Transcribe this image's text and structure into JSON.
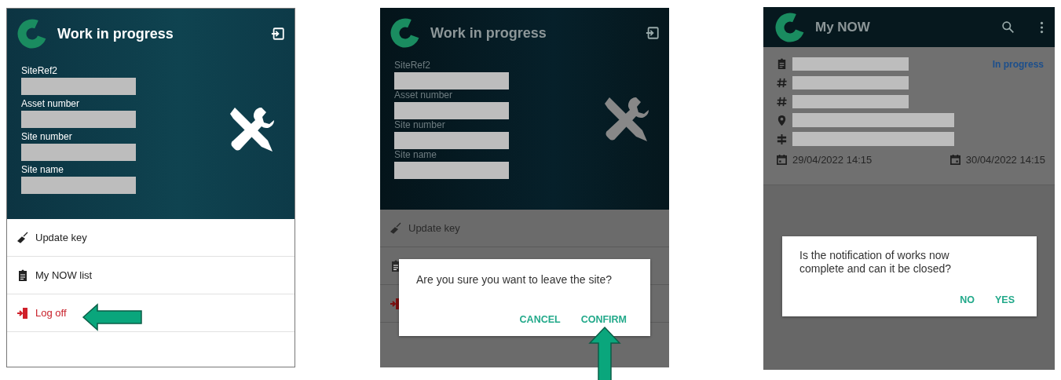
{
  "panels": [
    {
      "kind": "site",
      "dimmed": false,
      "title": "Work in progress",
      "fields": [
        "SiteRef2",
        "Asset number",
        "Site number",
        "Site name"
      ],
      "menu": [
        {
          "kind": "key",
          "label": "Update key"
        },
        {
          "kind": "list",
          "label": "My NOW list"
        },
        {
          "kind": "logoff",
          "label": "Log off"
        }
      ],
      "pointer": {
        "kind": "left"
      }
    },
    {
      "kind": "site",
      "dimmed": true,
      "title": "Work in progress",
      "fields": [
        "SiteRef2",
        "Asset number",
        "Site number",
        "Site name"
      ],
      "menu": [
        {
          "kind": "key",
          "label": "Update key"
        },
        {
          "kind": "list"
        },
        {
          "kind": "logoff"
        }
      ],
      "dialog": {
        "message": "Are you sure you want to leave the site?",
        "buttons": [
          "CANCEL",
          "CONFIRM"
        ]
      },
      "pointer": {
        "kind": "up"
      }
    },
    {
      "kind": "now",
      "dimmed": true,
      "title": "My NOW",
      "status": "In progress",
      "rows": [
        {
          "kind": "clipboard"
        },
        {
          "kind": "hash"
        },
        {
          "kind": "hash"
        },
        {
          "kind": "pin"
        },
        {
          "kind": "signpost"
        }
      ],
      "dates": [
        "29/04/2022 14:15",
        "30/04/2022 14:15"
      ],
      "dialog": {
        "message": "Is the notification of works now complete and can it be closed?",
        "buttons": [
          "NO",
          "YES"
        ]
      }
    }
  ]
}
